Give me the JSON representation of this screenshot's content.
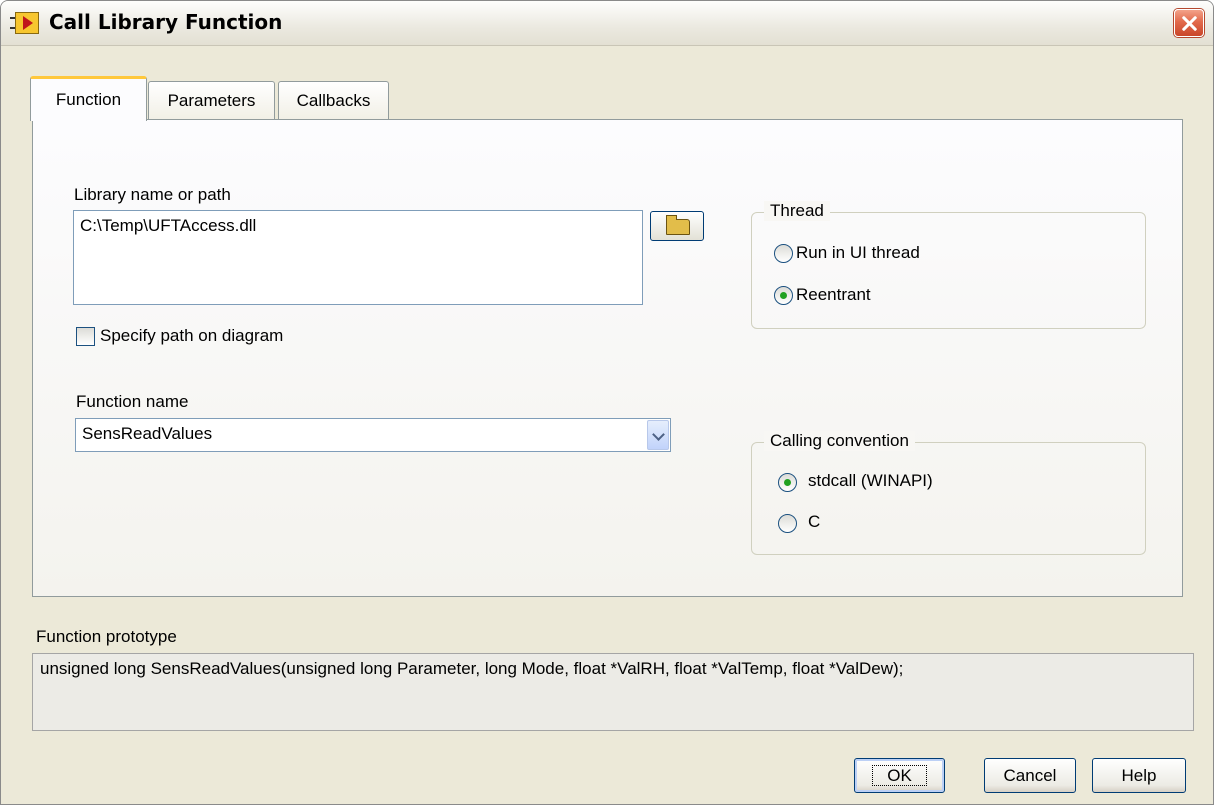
{
  "window": {
    "title": "Call Library Function"
  },
  "tabs": [
    {
      "label": "Function",
      "active": true
    },
    {
      "label": "Parameters",
      "active": false
    },
    {
      "label": "Callbacks",
      "active": false
    }
  ],
  "library": {
    "label": "Library name or path",
    "path": "C:\\Temp\\UFTAccess.dll",
    "specify_path_label": "Specify path on diagram",
    "specify_path_checked": false
  },
  "function": {
    "label": "Function name",
    "selected": "SensReadValues"
  },
  "thread": {
    "title": "Thread",
    "options": [
      {
        "label": "Run in UI thread",
        "selected": false
      },
      {
        "label": "Reentrant",
        "selected": true
      }
    ]
  },
  "calling_convention": {
    "title": "Calling convention",
    "options": [
      {
        "label": "stdcall (WINAPI)",
        "selected": true
      },
      {
        "label": "C",
        "selected": false
      }
    ]
  },
  "prototype": {
    "label": "Function prototype",
    "text": "unsigned long SensReadValues(unsigned long Parameter, long Mode, float *ValRH, float *ValTemp, float *ValDew);"
  },
  "buttons": {
    "ok": "OK",
    "cancel": "Cancel",
    "help": "Help"
  },
  "icons": {
    "app": "labview-vi-icon",
    "close": "close-icon",
    "browse": "folder-open-icon",
    "dropdown": "chevron-down-icon"
  }
}
